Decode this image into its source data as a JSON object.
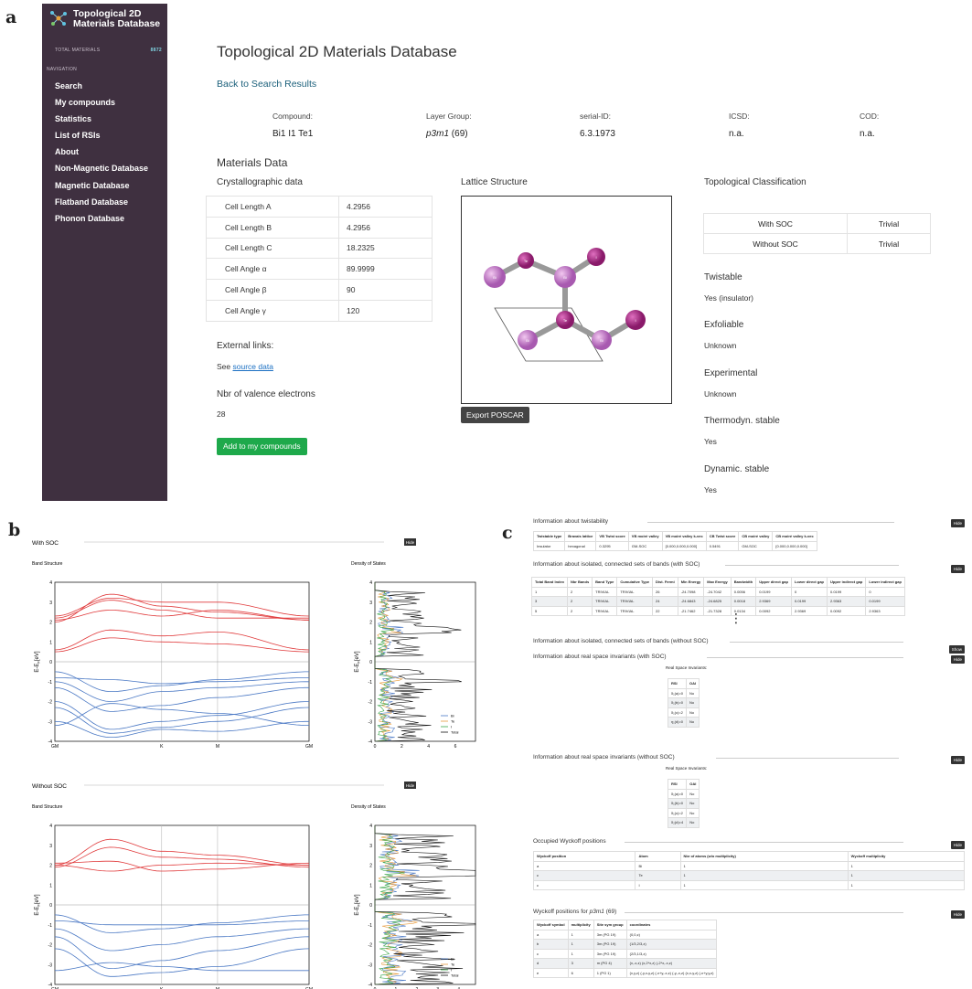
{
  "panel_labels": {
    "a": "a",
    "b": "b",
    "c": "c"
  },
  "sidebar": {
    "title_line1": "Topological 2D",
    "title_line2": "Materials Database",
    "total_label": "TOTAL MATERIALS",
    "total_value": "8872",
    "nav_heading": "NAVIGATION",
    "items": [
      "Search",
      "My compounds",
      "Statistics",
      "List of RSIs",
      "About",
      "Non-Magnetic Database",
      "Magnetic Database",
      "Flatband Database",
      "Phonon Database"
    ]
  },
  "page": {
    "title": "Topological 2D Materials Database",
    "back_link": "Back to Search Results"
  },
  "compound": {
    "labels": [
      "Compound:",
      "Layer Group:",
      "serial-ID:",
      "ICSD:",
      "COD:"
    ],
    "compound": "Bi1 I1 Te1",
    "layer_group_symbol": "p3m1",
    "layer_group_num": "(69)",
    "serial": "6.3.1973",
    "icsd": "n.a.",
    "cod": "n.a."
  },
  "materials": {
    "heading": "Materials Data",
    "crys_heading": "Crystallographic data",
    "rows": [
      {
        "label": "Cell Length A",
        "value": "4.2956"
      },
      {
        "label": "Cell Length B",
        "value": "4.2956"
      },
      {
        "label": "Cell Length C",
        "value": "18.2325"
      },
      {
        "label": "Cell Angle α",
        "value": "89.9999"
      },
      {
        "label": "Cell Angle β",
        "value": "90"
      },
      {
        "label": "Cell Angle γ",
        "value": "120"
      }
    ],
    "external": "External links:",
    "see": "See",
    "source": "source data",
    "valence_heading": "Nbr of valence electrons",
    "valence": "28",
    "add_button": "Add to my compounds"
  },
  "lattice": {
    "heading": "Lattice Structure",
    "export": "Export POSCAR",
    "atom_labels": {
      "bi": "Bi",
      "te": "Te",
      "i": "I"
    }
  },
  "topo": {
    "heading": "Topological Classification",
    "rows": [
      {
        "label": "With SOC",
        "value": "Trivial"
      },
      {
        "label": "Without SOC",
        "value": "Trivial"
      }
    ],
    "props": [
      {
        "label": "Twistable",
        "value": "Yes (insulator)"
      },
      {
        "label": "Exfoliable",
        "value": "Unknown"
      },
      {
        "label": "Experimental",
        "value": "Unknown"
      },
      {
        "label": "Thermodyn. stable",
        "value": "Yes"
      },
      {
        "label": "Dynamic. stable",
        "value": "Yes"
      }
    ]
  },
  "bands": {
    "hide": "Hide",
    "band_title": "Band Structure",
    "dos_title": "Density of States",
    "with_soc": "With SOC",
    "without_soc": "Without SOC",
    "kpoints": [
      "GM",
      "K",
      "M",
      "GM"
    ],
    "yticks": [
      "4",
      "3",
      "2",
      "1",
      "0",
      "-1",
      "-2",
      "-3",
      "-4"
    ],
    "ylabel": "E-E",
    "ylabel_sub": "F",
    "ylabel_unit": "[eV]",
    "dos_xticks_soc": [
      "0",
      "2",
      "4",
      "6"
    ],
    "dos_xticks_nosoc": [
      "0",
      "1",
      "2",
      "3",
      "4"
    ],
    "legend": [
      "Bi",
      "Te",
      "I",
      "Total"
    ],
    "colors": {
      "conduction": "#e0393a",
      "valence": "#4a78c4",
      "bi": "#4a78c4",
      "te": "#e69a3c",
      "i": "#3aa64a",
      "total": "#111111"
    }
  },
  "twist": {
    "heading": "Information about twistability",
    "hide": "Hide",
    "headers": [
      "Twistable type",
      "Bravais lattice",
      "VB Twist score",
      "VB moiré valley",
      "VB moiré valley k-vec",
      "CB Twist score",
      "CB moiré valley",
      "CB moiré valley k-vec"
    ],
    "row": [
      "Insulator",
      "hexagonal",
      "0.3295",
      "GM-SOC",
      "[0.000,0.000,0.000]",
      "0.5491",
      "GM-SOC",
      "[0.000,0.000,0.000]"
    ]
  },
  "isolated": {
    "heading": "Information about isolated, connected sets of bands (with SOC)",
    "hide": "Hide",
    "headers": [
      "Total Band Index",
      "Nbr Bands",
      "Band Type",
      "Cumulative Type",
      "Dist. Fermi",
      "Min Energy",
      "Max Energy",
      "Bandwidth",
      "Upper direct gap",
      "Lower direct gap",
      "Upper indirect gap",
      "Lower indirect gap"
    ],
    "rows": [
      [
        "1",
        "2",
        "TRIVIAL",
        "TRIVIAL",
        "26",
        "-24.7098",
        "-24.7042",
        "0.0056",
        "0.0199",
        "0",
        "0.0199",
        "0"
      ],
      [
        "3",
        "2",
        "TRIVIAL",
        "TRIVIAL",
        "24",
        "-24.6843",
        "-24.6825",
        "0.0018",
        "2.9369",
        "0.0199",
        "2.9363",
        "0.0199"
      ],
      [
        "5",
        "2",
        "TRIVIAL",
        "TRIVIAL",
        "22",
        "-21.7462",
        "-21.7328",
        "0.0134",
        "0.0092",
        "2.9369",
        "0.0092",
        "2.9363"
      ]
    ],
    "ellipsis": "⋮",
    "nosoc_heading": "Information about isolated, connected sets of bands (without SOC)",
    "show": "Show"
  },
  "rsi_soc": {
    "heading": "Information about real space invariants (with SOC)",
    "hide": "Hide",
    "caption": "Real Space Invariants:",
    "headers": [
      "RSI",
      "OAI"
    ],
    "rows": [
      [
        "δ₁(a)=0",
        "No"
      ],
      [
        "δ₁(b)=0",
        "No"
      ],
      [
        "δ₁(c)=2",
        "No"
      ],
      [
        "η₁(d)=0",
        "No"
      ]
    ]
  },
  "rsi_nosoc": {
    "heading": "Information about real space invariants (without SOC)",
    "hide": "Hide",
    "caption": "Real Space Invariants:",
    "headers": [
      "RSI",
      "OAI"
    ],
    "rows": [
      [
        "δ₁(a)=0",
        "No"
      ],
      [
        "δ₁(b)=0",
        "No"
      ],
      [
        "δ₁(c)=2",
        "No"
      ],
      [
        "δ₂(d)=4",
        "No"
      ]
    ]
  },
  "wyckoff": {
    "heading": "Occupied Wyckoff positions",
    "hide": "Hide",
    "headers": [
      "Wyckoff position",
      "Atom",
      "Nbr of atoms (w/o multiplicity)",
      "Wyckoff multiplicity"
    ],
    "rows": [
      [
        "a",
        "Bi",
        "1",
        "1"
      ],
      [
        "c",
        "Te",
        "1",
        "1"
      ],
      [
        "c",
        "I",
        "1",
        "1"
      ]
    ]
  },
  "wyckoff2": {
    "heading_pre": "Wyckoff positions for",
    "group": "p3m1",
    "group_num": "(69)",
    "hide": "Hide",
    "headers": [
      "Wyckoff symbol",
      "multiplicity",
      "Site sym group",
      "coordinates"
    ],
    "rows": [
      [
        "a",
        "1",
        "3m (PG 19)",
        "(0,0,z)"
      ],
      [
        "b",
        "1",
        "3m (PG 19)",
        "(1/3,2/3,z)"
      ],
      [
        "c",
        "1",
        "3m (PG 19)",
        "(2/3,1/3,z)"
      ],
      [
        "d",
        "3",
        "m (PG 4)",
        "(x,-x,z) (x,2*x,z) (-2*x,-x,z)"
      ],
      [
        "e",
        "6",
        "1 (PG 1)",
        "(x,y,z) (-y,x-y,z) (-x+y,-x,z) (-y,-x,z) (x,x-y,z) (-x+y,y,z)"
      ]
    ]
  }
}
